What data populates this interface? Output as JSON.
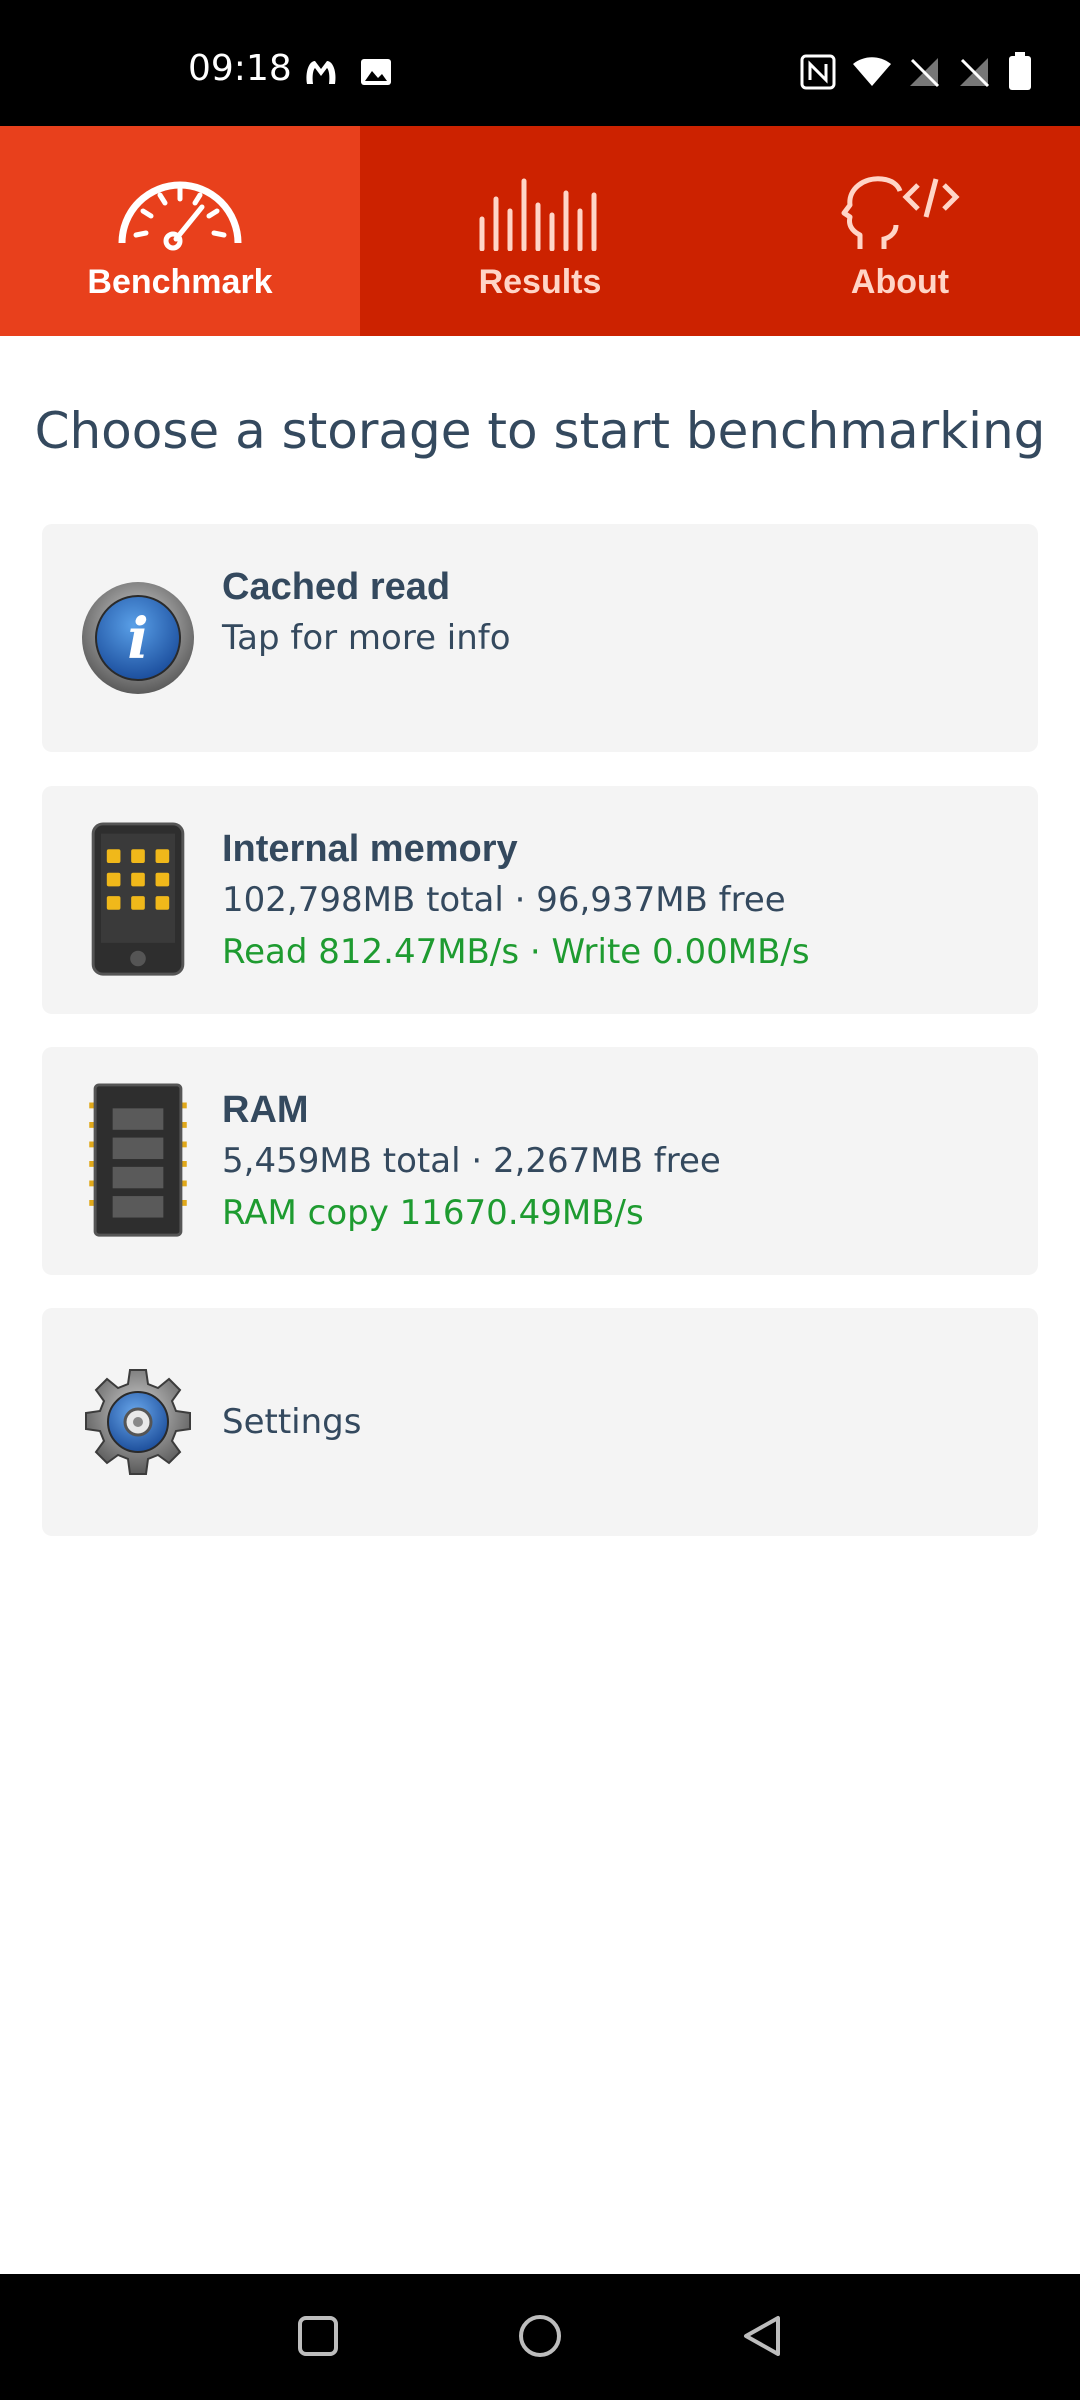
{
  "status_bar": {
    "time": "09:18",
    "icons": [
      "malwarebytes-icon",
      "image-icon",
      "nfc-icon",
      "wifi-icon",
      "no-sim-icon",
      "no-sim-icon",
      "battery-icon"
    ]
  },
  "tabs": [
    {
      "label": "Benchmark",
      "icon": "speedometer-icon",
      "active": true
    },
    {
      "label": "Results",
      "icon": "bars-icon",
      "active": false
    },
    {
      "label": "About",
      "icon": "head-code-icon",
      "active": false
    }
  ],
  "heading": "Choose a storage to start benchmarking",
  "cards": {
    "cached_read": {
      "title": "Cached read",
      "subtitle": "Tap for more info"
    },
    "internal_memory": {
      "title": "Internal memory",
      "info": "102,798MB total · 96,937MB free",
      "speed": "Read 812.47MB/s · Write 0.00MB/s"
    },
    "ram": {
      "title": "RAM",
      "info": "5,459MB total · 2,267MB free",
      "speed": "RAM copy 11670.49MB/s"
    },
    "settings": {
      "label": "Settings"
    }
  },
  "colors": {
    "tab_active": "#e8401c",
    "tab_inactive": "#cc2200",
    "heading_text": "#34495e",
    "speed_text": "#1e9b30",
    "card_bg": "#f4f4f4"
  }
}
